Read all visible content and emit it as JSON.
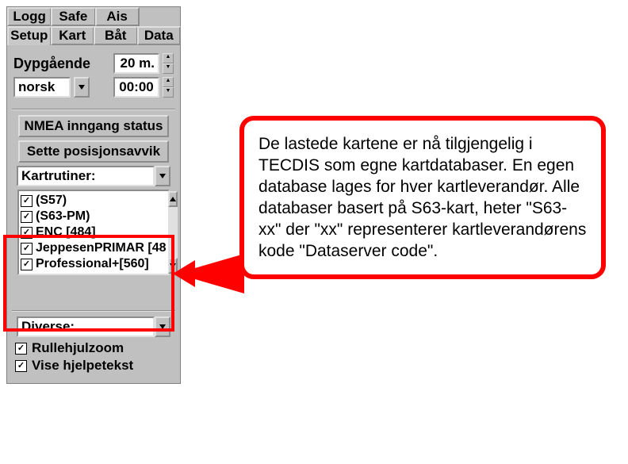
{
  "tabs_top": [
    "Logg",
    "Safe",
    "Ais"
  ],
  "tabs_bottom": [
    "Setup",
    "Kart",
    "Båt",
    "Data"
  ],
  "active_tab": "Setup",
  "depth_label": "Dypgående",
  "depth_value": "20 m.",
  "lang_value": "norsk",
  "time_value": "00:00",
  "btn_nmea": "NMEA inngang status",
  "btn_pos": "Sette posisjonsavvik",
  "dd_kart": "Kartrutiner:",
  "chart_items": [
    {
      "label": "(S57)",
      "checked": true
    },
    {
      "label": "(S63-PM)",
      "checked": true
    },
    {
      "label": "ENC [484]",
      "checked": true
    },
    {
      "label": "JeppesenPRIMAR [48",
      "checked": true
    },
    {
      "label": "Professional+[560]",
      "checked": true
    }
  ],
  "dd_diverse": "Diverse:",
  "cb_wheel": "Rullehjulzoom",
  "cb_help": "Vise hjelpetekst",
  "callout_text": "De lastede kartene er nå tilgjengelig i TECDIS som egne kartdatabaser. En egen database lages for hver kartleverandør. Alle databaser basert på S63-kart, heter \"S63-xx\" der \"xx\" representerer kartleverandørens kode \"Dataserver code\"."
}
